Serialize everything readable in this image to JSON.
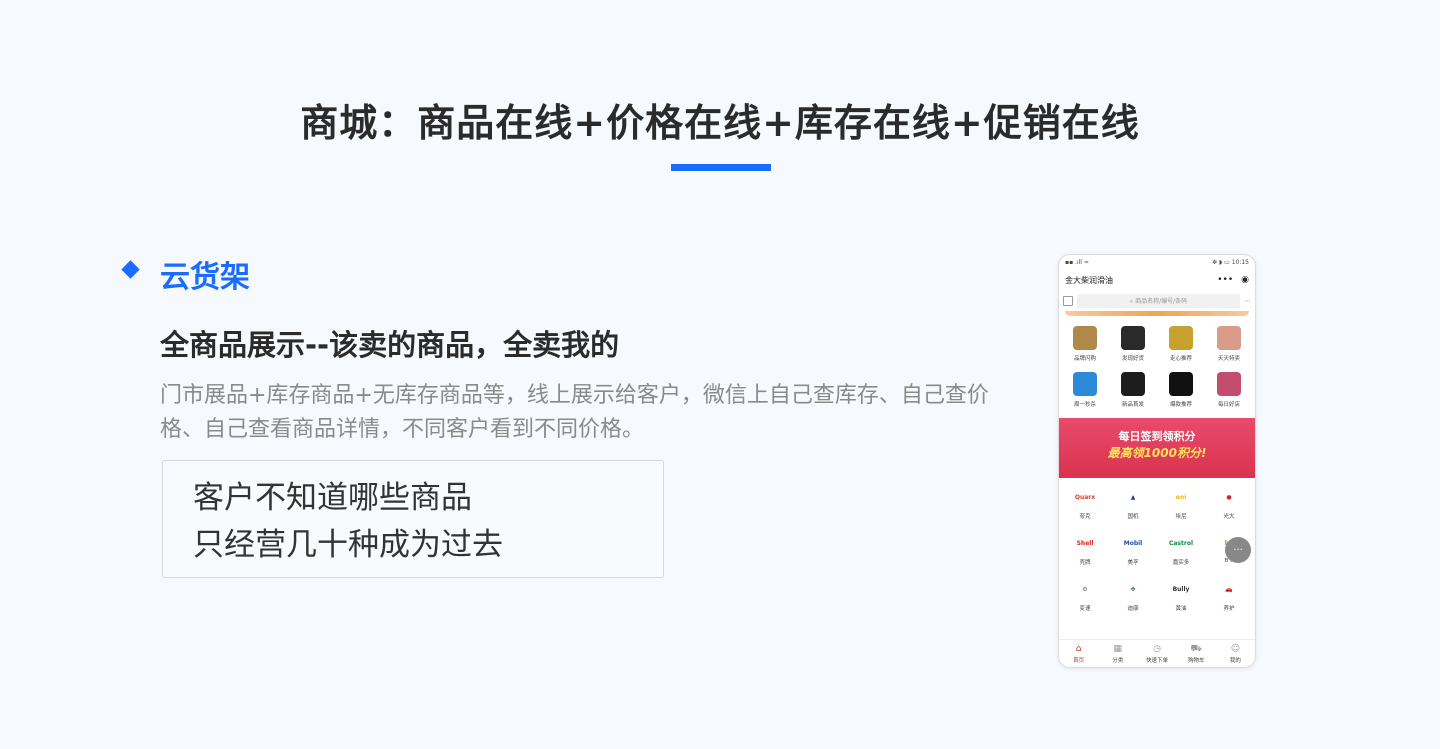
{
  "page": {
    "title": "商城：商品在线+价格在线+库存在线+促销在线",
    "accent_color": "#1a6cff"
  },
  "section": {
    "title": "云货架",
    "subheading": "全商品展示--该卖的商品，全卖我的",
    "description": "门市展品+库存商品+无库存商品等，线上展示给客户，微信上自己查库存、自己查价格、自己查看商品详情，不同客户看到不同价格。",
    "quote_lines": [
      "客户不知道哪些商品",
      "只经营几十种成为过去"
    ]
  },
  "phone": {
    "status_left": "▪▪ .ıll ≈",
    "status_right": "✻ ◗ ▭ 10:15",
    "app_title": "金大柴润滑油",
    "capsule_icons": [
      "•••",
      "◉"
    ],
    "search_placeholder": "⌕ 商品名称/编号/条码",
    "category_items": [
      {
        "label": "品牌闪购",
        "color": "#b0894a"
      },
      {
        "label": "发现好货",
        "color": "#2a2a2a"
      },
      {
        "label": "走心推荐",
        "color": "#c8a02e"
      },
      {
        "label": "天天特卖",
        "color": "#d99b8a"
      },
      {
        "label": "周一秒杀",
        "color": "#2d8ad8"
      },
      {
        "label": "新品首发",
        "color": "#1d1d1d"
      },
      {
        "label": "爆款推荐",
        "color": "#111111"
      },
      {
        "label": "每日好店",
        "color": "#c24d6e"
      }
    ],
    "promo": {
      "line1": "每日签到领积分",
      "line2": "最高领1000积分!"
    },
    "brands": [
      {
        "label": "夸克",
        "logo": "Quarx",
        "color": "#e63a2a"
      },
      {
        "label": "国机",
        "logo": "▲",
        "color": "#1b3f8a"
      },
      {
        "label": "埃尼",
        "logo": "eni",
        "color": "#e6b800"
      },
      {
        "label": "光大",
        "logo": "●",
        "color": "#d4222a"
      },
      {
        "label": "壳牌",
        "logo": "Shell",
        "color": "#e2231a"
      },
      {
        "label": "美孚",
        "logo": "Mobil",
        "color": "#1b4fa0"
      },
      {
        "label": "嘉实多",
        "logo": "Castrol",
        "color": "#0d8a3b"
      },
      {
        "label": "B P",
        "logo": "bp",
        "color": "#67b32e"
      },
      {
        "label": "变速",
        "logo": "⚙",
        "color": "#666666"
      },
      {
        "label": "迪康",
        "logo": "✤",
        "color": "#2e7d32"
      },
      {
        "label": "黄油",
        "logo": "Bully",
        "color": "#333333"
      },
      {
        "label": "养护",
        "logo": "🚗",
        "color": "#1fa3a3"
      }
    ],
    "chat_icon": "···",
    "tabs": [
      {
        "label": "首页",
        "icon": "⌂",
        "active": true
      },
      {
        "label": "分类",
        "icon": "▦",
        "active": false
      },
      {
        "label": "快速下单",
        "icon": "◷",
        "active": false
      },
      {
        "label": "购物车",
        "icon": "⛟",
        "active": false
      },
      {
        "label": "我的",
        "icon": "☺",
        "active": false
      }
    ]
  }
}
